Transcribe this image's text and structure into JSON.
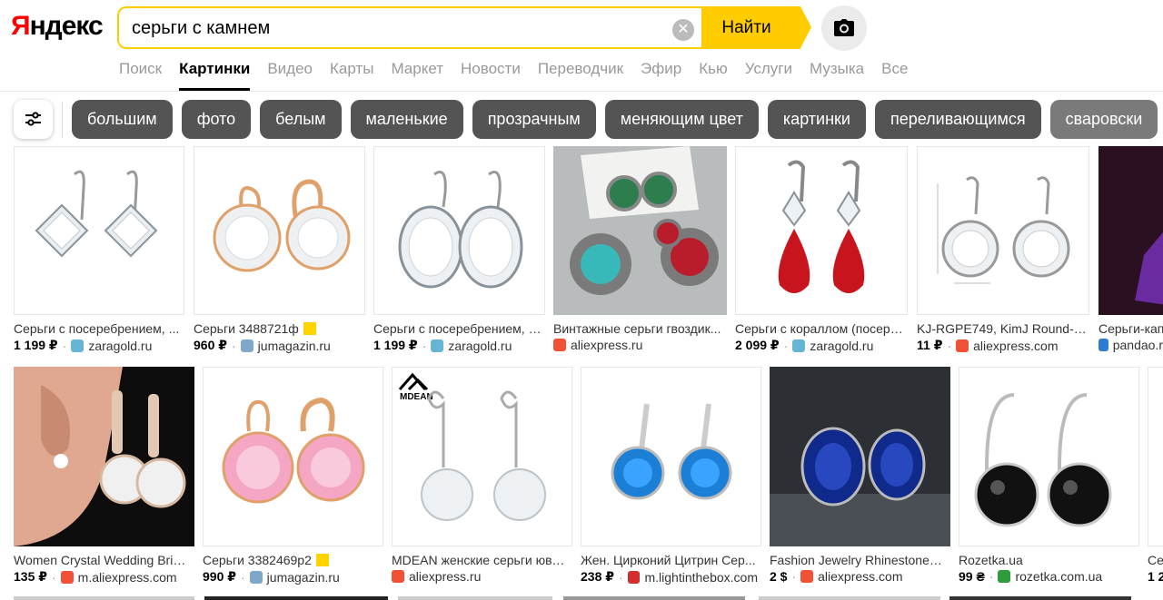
{
  "header": {
    "logo": "Яндекс",
    "search_value": "серьги с камнем",
    "find_label": "Найти"
  },
  "nav": [
    "Поиск",
    "Картинки",
    "Видео",
    "Карты",
    "Маркет",
    "Новости",
    "Переводчик",
    "Эфир",
    "Кью",
    "Услуги",
    "Музыка",
    "Все"
  ],
  "nav_active": "Картинки",
  "chips": [
    "большим",
    "фото",
    "белым",
    "маленькие",
    "прозрачным",
    "меняющим цвет",
    "картинки",
    "переливающимся",
    "сваровски"
  ],
  "row1": [
    {
      "title": "Серьги с посеребрением, ...",
      "price": "1 199 ₽",
      "source": "zaragold.ru",
      "icon": "zaragold-icon"
    },
    {
      "title": "Серьги 3488721ф",
      "price": "960 ₽",
      "source": "jumagazin.ru",
      "icon": "jumagazin-icon"
    },
    {
      "title": "Серьги с посеребрением, С...",
      "price": "1 199 ₽",
      "source": "zaragold.ru",
      "icon": "zaragold-icon"
    },
    {
      "title": "Винтажные серьги гвоздик...",
      "price": "",
      "source": "aliexpress.ru",
      "icon": "aliexpress-icon"
    },
    {
      "title": "Серьги с кораллом (посере...",
      "price": "2 099 ₽",
      "source": "zaragold.ru",
      "icon": "zaragold-icon"
    },
    {
      "title": "KJ-RGPE749, KimJ Round-2...",
      "price": "11 ₽",
      "source": "aliexpress.com",
      "icon": "aliexpress-icon"
    },
    {
      "title": "Серьги-капе",
      "price": "",
      "source": "pandao.r",
      "icon": "pandao-icon"
    }
  ],
  "row2": [
    {
      "title": "Women Crystal Wedding Bride...",
      "price": "135 ₽",
      "source": "m.aliexpress.com",
      "icon": "aliexpress-icon"
    },
    {
      "title": "Серьги 3382469р2",
      "price": "990 ₽",
      "source": "jumagazin.ru",
      "icon": "jumagazin-icon"
    },
    {
      "title": "MDEAN женские серьги юве...",
      "price": "",
      "source": "aliexpress.ru",
      "icon": "aliexpress-icon"
    },
    {
      "title": "Жен. Цирконий Цитрин Сер...",
      "price": "238 ₽",
      "source": "m.lightinthebox.com",
      "icon": "lightinthebox-icon"
    },
    {
      "title": "Fashion Jewelry Rhinestones ...",
      "price": "2 $",
      "source": "aliexpress.com",
      "icon": "aliexpress-icon"
    },
    {
      "title": "Rozetka.ua",
      "price": "99 ₴",
      "source": "rozetka.com.ua",
      "icon": "rozetka-icon"
    },
    {
      "title": "Се",
      "price": "1 2",
      "source": "",
      "icon": ""
    }
  ],
  "image_text": {
    "mdean_logo": "MDEAN"
  },
  "colors": {
    "search_accent": "#ffcc00",
    "chip_bg": "#545454",
    "logo_red": "#ff0000"
  }
}
